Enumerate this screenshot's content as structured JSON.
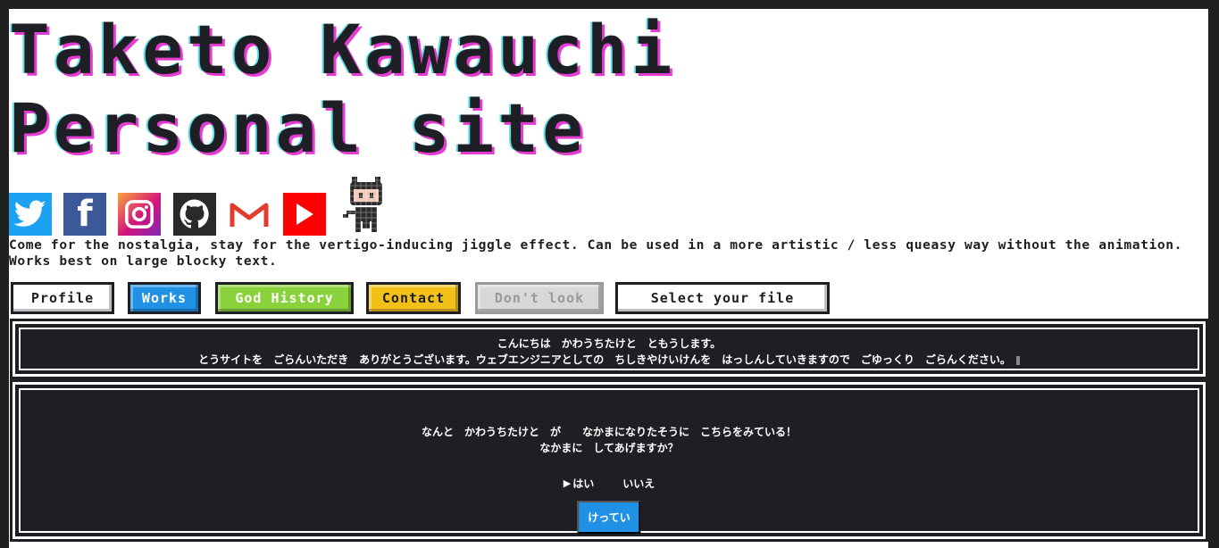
{
  "header": {
    "title_line1": "Taketo Kawauchi",
    "title_line2": "Personal site"
  },
  "social": {
    "icons": [
      "twitter-icon",
      "facebook-icon",
      "instagram-icon",
      "github-icon",
      "gmail-icon",
      "youtube-icon",
      "octocat-icon"
    ],
    "facebook_glyph": "f"
  },
  "tagline": "Come for the nostalgia, stay for the vertigo-inducing jiggle effect. Can be used in a more artistic / less queasy way without the animation. Works best on large blocky text.",
  "nav": {
    "profile": "Profile",
    "works": "Works",
    "god_history": "God History",
    "contact": "Contact",
    "dont_look": "Don't look",
    "select_file": "Select your file"
  },
  "dialog1": {
    "line1": "こんにちは　かわうちたけと　ともうします。",
    "line2": "とうサイトを　ごらんいただき　ありがとうございます。ウェブエンジニアとしての　ちしきやけいけんを　はっしんしていきますので　ごゆっくり　ごらんください。"
  },
  "dialog2": {
    "line1": "なんと　かわうちたけと　が　　なかまになりたそうに　こちらをみている！",
    "line2": "なかまに　してあげますか？",
    "choice_yes": "はい",
    "choice_no": "いいえ",
    "selector_glyph": "▶",
    "confirm": "けってい"
  },
  "colors": {
    "background": "#202020",
    "page": "#ffffff",
    "text": "#1e1f24",
    "title_shadow_pink": "#e43bd2",
    "title_shadow_cyan": "#5ce0e6",
    "works_blue": "#2191e6",
    "god_green": "#8ad23b",
    "contact_yellow": "#f2c017",
    "dialog_bg": "#1e1f24"
  }
}
